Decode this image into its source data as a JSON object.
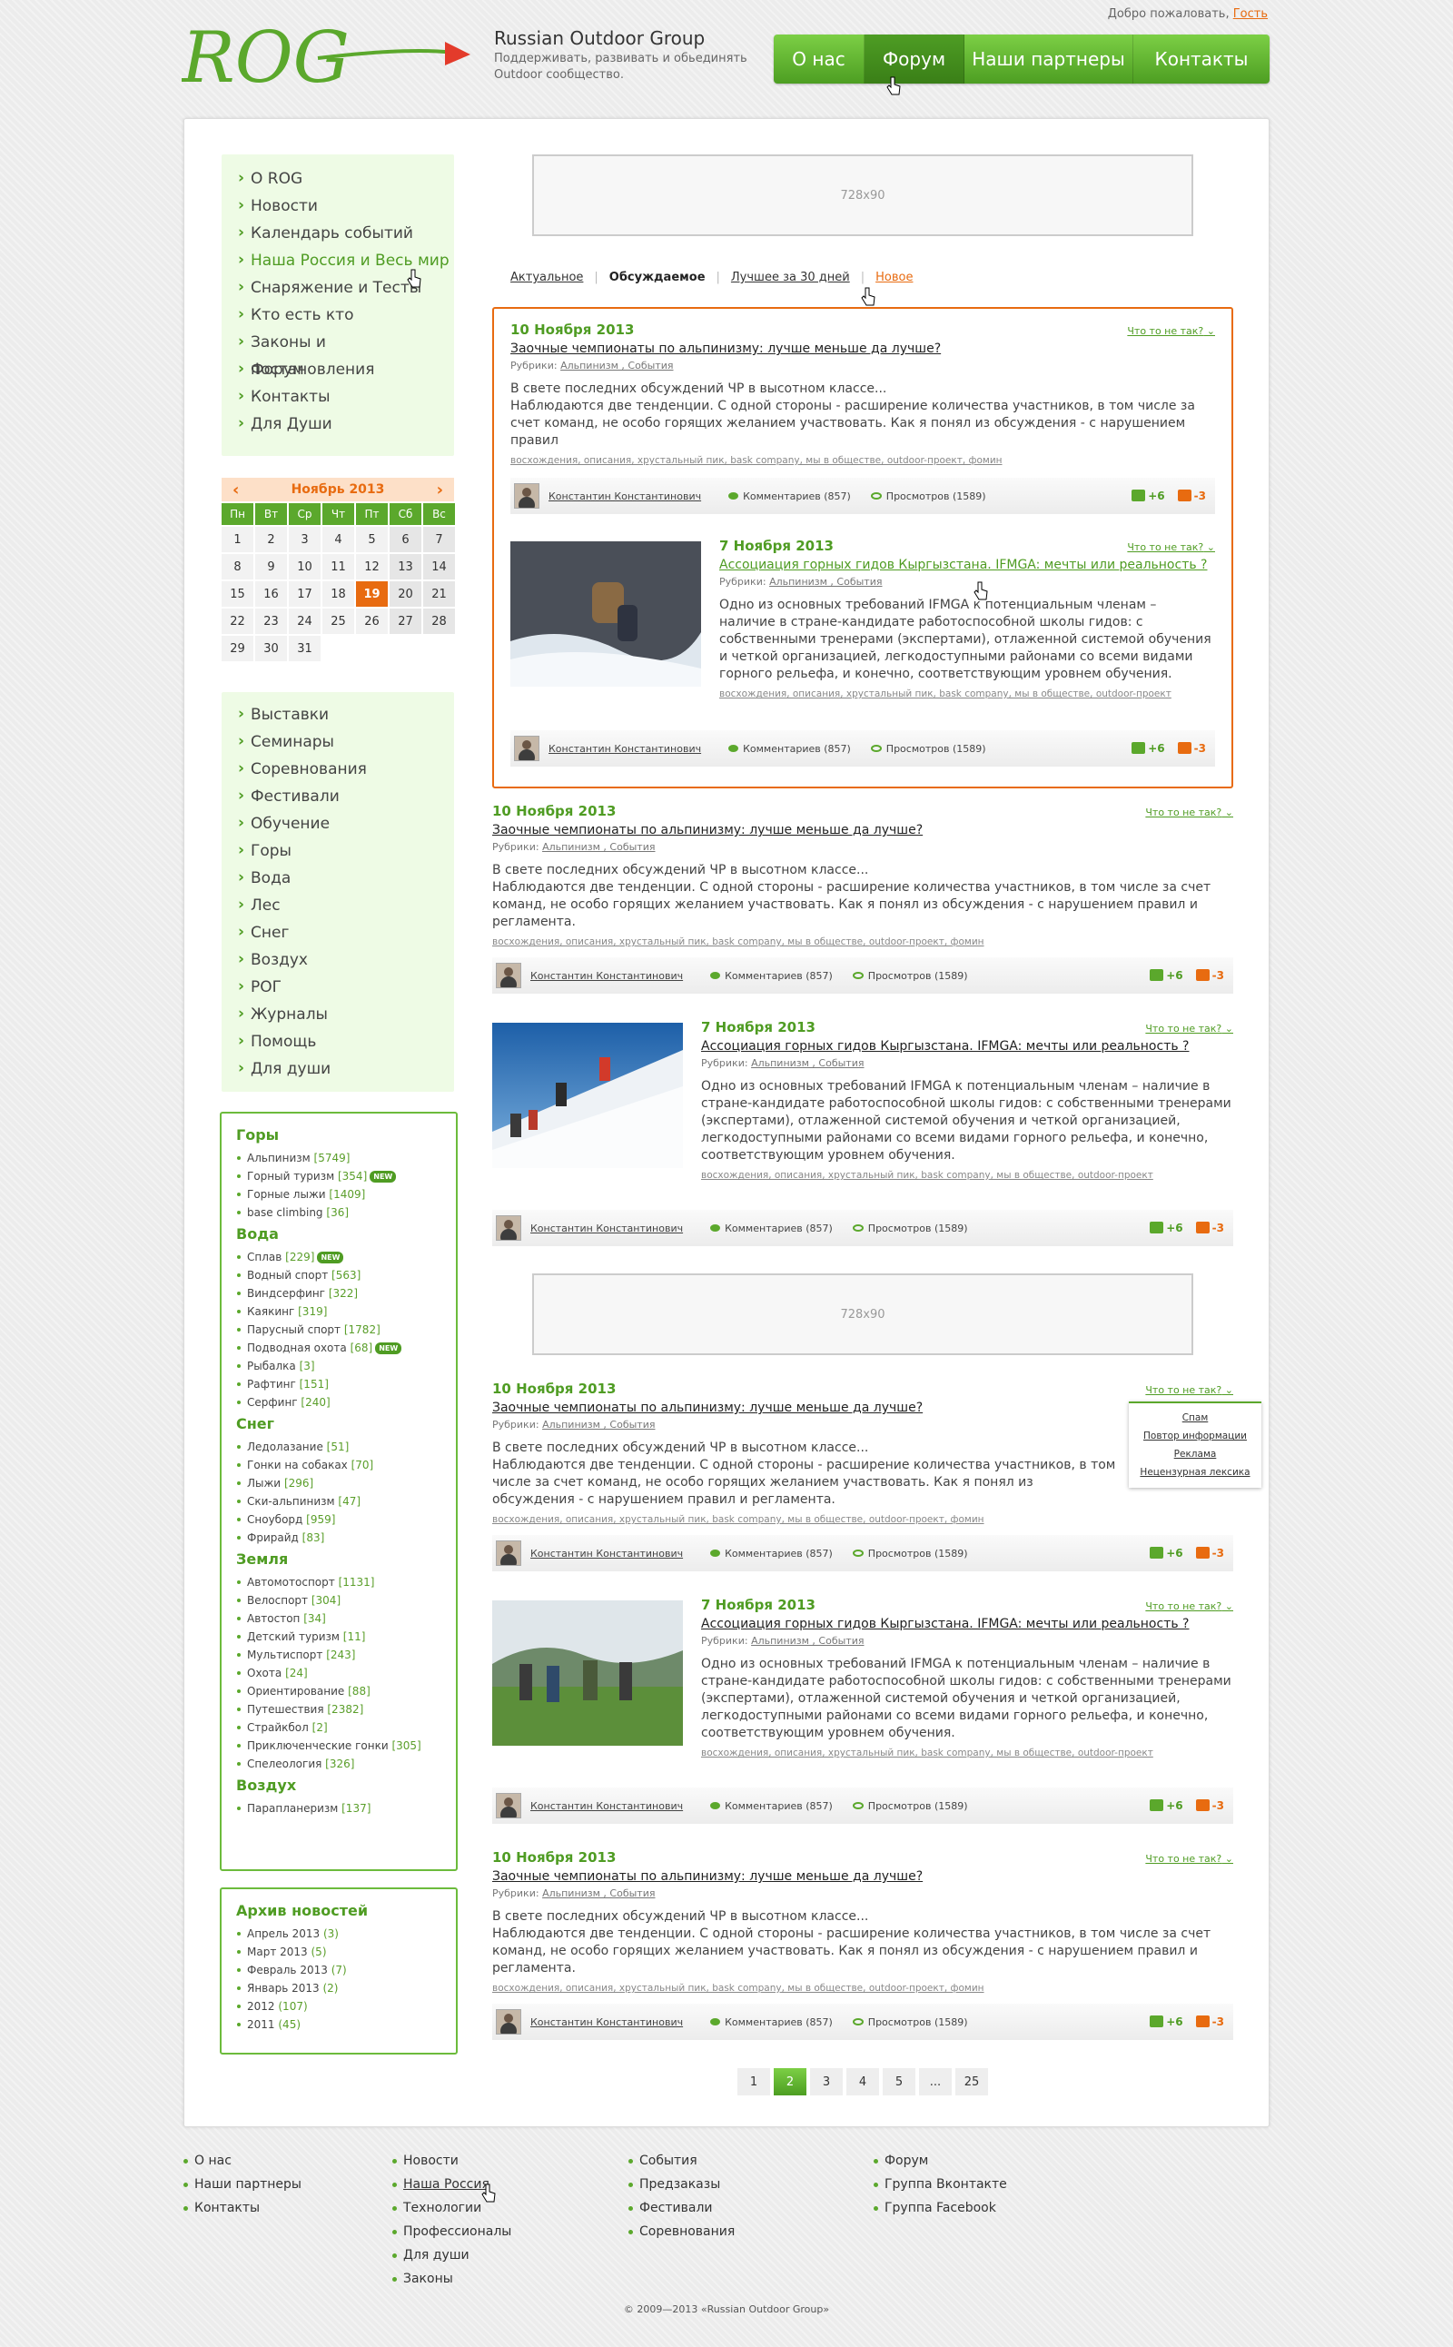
{
  "header": {
    "logo_text": "ROG",
    "site_title": "Russian Outdoor Group",
    "slogan": "Поддерживать, развивать и обьединять Outdoor сообщество.",
    "greeting": "Добро пожаловать,",
    "guest": "Гость",
    "nav": [
      "О нас",
      "Форум",
      "Наши партнеры",
      "Контакты"
    ],
    "nav_active": "Форум"
  },
  "sidebar": {
    "menu1": [
      "О ROG",
      "Новости",
      "Календарь событий",
      "Наша Россия и Весь мир",
      "Снаряжение и Тесты",
      "Кто есть кто",
      "Законы и постановления",
      "Форум",
      "Контакты",
      "Для Души"
    ],
    "menu1_highlight": "Наша Россия и Весь мир",
    "calendar": {
      "month": "Ноябрь 2013",
      "days_of_week": [
        "Пн",
        "Вт",
        "Ср",
        "Чт",
        "Пт",
        "Сб",
        "Вс"
      ],
      "days": [
        "1",
        "2",
        "3",
        "4",
        "5",
        "6",
        "7",
        "8",
        "9",
        "10",
        "11",
        "12",
        "13",
        "14",
        "15",
        "16",
        "17",
        "18",
        "19",
        "20",
        "21",
        "22",
        "23",
        "24",
        "25",
        "26",
        "27",
        "28",
        "29",
        "30",
        "31"
      ],
      "today": "19"
    },
    "menu2": [
      "Выставки",
      "Семинары",
      "Соревнования",
      "Фестивали",
      "Обучение",
      "Горы",
      "Вода",
      "Лес",
      "Снег",
      "Воздух",
      "РОГ",
      "Журналы",
      "Помощь",
      "Для души"
    ],
    "categories": [
      {
        "heading": "Горы",
        "items": [
          {
            "name": "Альпинизм",
            "count": "[5749]"
          },
          {
            "name": "Горный туризм",
            "count": "[354]",
            "new": "NEW"
          },
          {
            "name": "Горные лыжи",
            "count": "[1409]"
          },
          {
            "name": "base climbing",
            "count": "[36]"
          }
        ]
      },
      {
        "heading": "Вода",
        "items": [
          {
            "name": "Сплав",
            "count": "[229]",
            "new": "NEW"
          },
          {
            "name": "Водный спорт",
            "count": "[563]"
          },
          {
            "name": "Виндсерфинг",
            "count": "[322]"
          },
          {
            "name": "Каякинг",
            "count": "[319]"
          },
          {
            "name": "Парусный спорт",
            "count": "[1782]"
          },
          {
            "name": "Подводная охота",
            "count": "[68]",
            "new": "NEW"
          },
          {
            "name": "Рыбалка",
            "count": "[3]"
          },
          {
            "name": "Рафтинг",
            "count": "[151]"
          },
          {
            "name": "Серфинг",
            "count": "[240]"
          }
        ]
      },
      {
        "heading": "Снег",
        "items": [
          {
            "name": "Ледолазание",
            "count": "[51]"
          },
          {
            "name": "Гонки на собаках",
            "count": "[70]"
          },
          {
            "name": "Лыжи",
            "count": "[296]"
          },
          {
            "name": "Ски-альпинизм",
            "count": "[47]"
          },
          {
            "name": "Сноуборд",
            "count": "[959]"
          },
          {
            "name": "Фрирайд",
            "count": "[83]"
          }
        ]
      },
      {
        "heading": "Земля",
        "items": [
          {
            "name": "Автомотоспорт",
            "count": "[1131]"
          },
          {
            "name": "Велоспорт",
            "count": "[304]"
          },
          {
            "name": "Автостоп",
            "count": "[34]"
          },
          {
            "name": "Детский туризм",
            "count": "[11]"
          },
          {
            "name": "Мультиспорт",
            "count": "[243]"
          },
          {
            "name": "Охота",
            "count": "[24]"
          },
          {
            "name": "Ориентирование",
            "count": "[88]"
          },
          {
            "name": "Путешествия",
            "count": "[2382]"
          },
          {
            "name": "Страйкбол",
            "count": "[2]"
          },
          {
            "name": "Приключенческие гонки",
            "count": "[305]"
          },
          {
            "name": "Спелеология",
            "count": "[326]"
          }
        ]
      },
      {
        "heading": "Воздух",
        "items": [
          {
            "name": "Парапланеризм",
            "count": "[137]"
          }
        ]
      }
    ],
    "archive": {
      "heading": "Архив новостей",
      "items": [
        {
          "name": "Апрель 2013",
          "count": "(3)"
        },
        {
          "name": "Март 2013",
          "count": "(5)"
        },
        {
          "name": "Февраль 2013",
          "count": "(7)"
        },
        {
          "name": "Январь 2013",
          "count": "(2)"
        },
        {
          "name": "2012",
          "count": "(107)"
        },
        {
          "name": "2011",
          "count": "(45)"
        }
      ]
    }
  },
  "banner_text": "728x90",
  "filters": [
    "Актуальное",
    "Обсуждаемое",
    "Лучшее за 30 дней",
    "Новое"
  ],
  "wrong_label": "Что то не так?",
  "rubrics_label": "Рубрики:",
  "articles": {
    "a": {
      "date": "10 Ноября 2013",
      "title": "Заочные чемпионаты по альпинизму: лучше меньше да лучше?",
      "rubrics": "Альпинизм , События",
      "text1": "В свете последних обсуждений ЧР в высотном классе...",
      "text2_featured": "Наблюдаются две тенденции. С одной стороны - расширение количества участников, в том числе за счет команд, не особо горящих желанием участвовать. Как я понял из обсуждения - с нарушением правил",
      "text2": "Наблюдаются две тенденции. С одной стороны - расширение количества участников, в том числе за счет команд, не особо горящих желанием участвовать. Как я понял из обсуждения - с нарушением правил и регламента.",
      "tags": "восхождения, описания, хрустальный пик, bask company, мы в обществе, outdoor-проект, фомин"
    },
    "b": {
      "date": "7 Ноября 2013",
      "title": "Ассоциация горных гидов Кыргызстана. IFMGA: мечты или реальность ?",
      "rubrics": "Альпинизм , События",
      "text": "Одно из основных требований IFMGA к потенциальным членам – наличие в стране-кандидате работоспособной школы гидов: с собственными тренерами (экспертами), отлаженной системой обучения и четкой организацией, легкодоступными районами со всеми видами горного рельефа, и конечно, соответствующим уровнем обучения.",
      "tags": "восхождения, описания, хрустальный пик, bask company, мы в обществе, outdoor-проект"
    },
    "footer": {
      "author": "Константин Константинович",
      "comments": "Комментариев (857)",
      "views": "Просмотров (1589)",
      "up": "+6",
      "down": "-3"
    }
  },
  "dropdown": [
    "Спам",
    "Повтор информации",
    "Реклама",
    "Нецензурная лексика"
  ],
  "pager": {
    "pages": [
      "1",
      "2",
      "3",
      "4",
      "5",
      "...",
      "25"
    ],
    "current": "2"
  },
  "footer": {
    "col1": [
      "О нас",
      "Наши партнеры",
      "Контакты"
    ],
    "col2": [
      "Новости",
      "Наша Россия",
      "Технологии",
      "Профессионалы",
      "Для души",
      "Законы"
    ],
    "col3": [
      "События",
      "Предзаказы",
      "Фестивали",
      "Соревнования"
    ],
    "col4": [
      "Форум",
      "Группа Вконтакте",
      "Группа Facebook"
    ],
    "copyright": "© 2009—2013 «Russian Outdoor Group»"
  },
  "colors": {
    "brand_green": "#5ba82c",
    "accent_orange": "#e86b10"
  }
}
